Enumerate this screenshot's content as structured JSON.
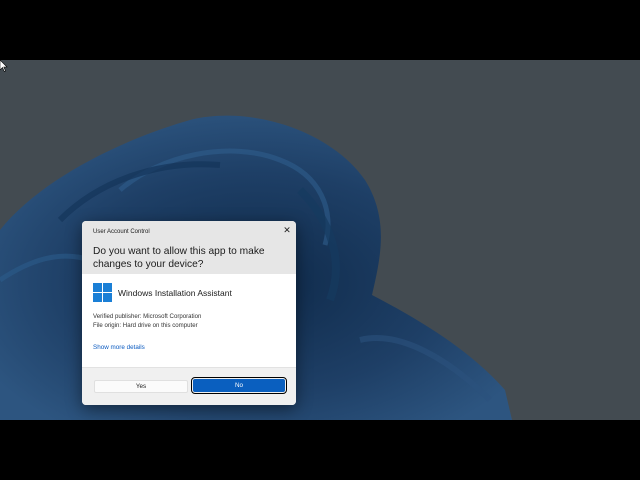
{
  "dialog": {
    "caption": "User Account Control",
    "question": "Do you want to allow this app to make changes to your device?",
    "app_name": "Windows Installation Assistant",
    "publisher": "Verified publisher: Microsoft Corporation",
    "file_origin": "File origin: Hard drive on this computer",
    "show_more": "Show more details",
    "yes_label": "Yes",
    "no_label": "No",
    "close_glyph": "✕"
  },
  "icons": {
    "app": "windows-logo-icon",
    "close": "close-icon",
    "cursor": "mouse-pointer-icon"
  },
  "colors": {
    "desktop_background": "#434b51",
    "bloom": "#1e3f66",
    "accent": "#0a5fbf",
    "link": "#0b5bc1"
  }
}
